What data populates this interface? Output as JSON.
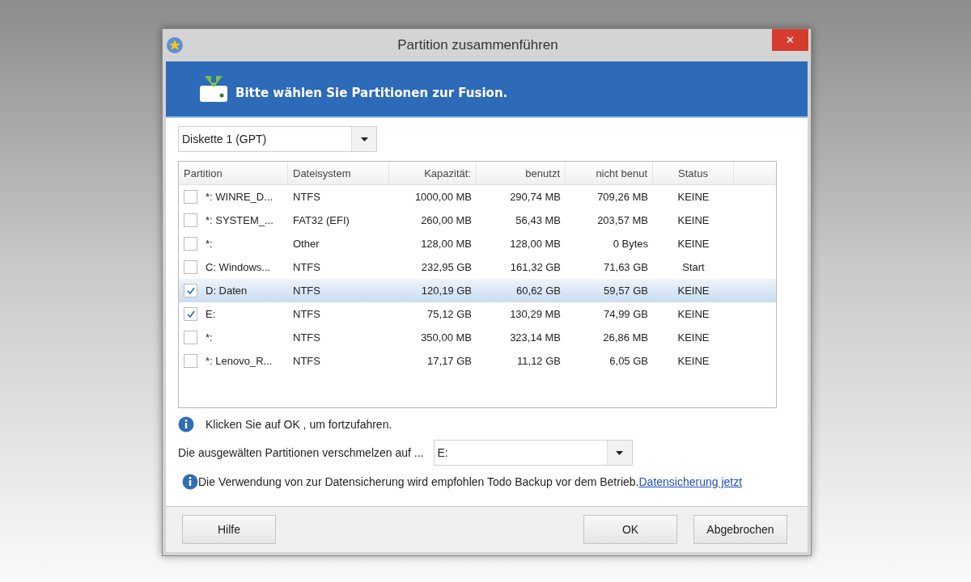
{
  "window": {
    "title": "Partition zusammenführen",
    "close": "✕"
  },
  "banner": {
    "text": "Bitte wählen Sie Partitionen zur Fusion."
  },
  "disk_select": {
    "value": "Diskette 1 (GPT)"
  },
  "table": {
    "columns": [
      "Partition",
      "Dateisystem",
      "Kapazität:",
      "benutzt",
      "nicht benut",
      "Status"
    ],
    "rows": [
      {
        "checked": false,
        "selected": false,
        "cells": [
          "*: WINRE_D...",
          "NTFS",
          "1000,00 MB",
          "290,74 MB",
          "709,26 MB",
          "KEINE"
        ]
      },
      {
        "checked": false,
        "selected": false,
        "cells": [
          "*: SYSTEM_...",
          "FAT32 (EFI)",
          "260,00 MB",
          "56,43 MB",
          "203,57 MB",
          "KEINE"
        ]
      },
      {
        "checked": false,
        "selected": false,
        "cells": [
          "*:",
          "Other",
          "128,00 MB",
          "128,00 MB",
          "0 Bytes",
          "KEINE"
        ]
      },
      {
        "checked": false,
        "selected": false,
        "cells": [
          "C: Windows...",
          "NTFS",
          "232,95 GB",
          "161,32 GB",
          "71,63 GB",
          "Start"
        ]
      },
      {
        "checked": true,
        "selected": true,
        "cells": [
          "D: Daten",
          "NTFS",
          "120,19 GB",
          "60,62 GB",
          "59,57 GB",
          "KEINE"
        ]
      },
      {
        "checked": true,
        "selected": false,
        "cells": [
          "E:",
          "NTFS",
          "75,12 GB",
          "130,29 MB",
          "74,99 GB",
          "KEINE"
        ]
      },
      {
        "checked": false,
        "selected": false,
        "cells": [
          "*:",
          "NTFS",
          "350,00 MB",
          "323,14 MB",
          "26,86 MB",
          "KEINE"
        ]
      },
      {
        "checked": false,
        "selected": false,
        "cells": [
          "*: Lenovo_R...",
          "NTFS",
          "17,17 GB",
          "11,12 GB",
          "6,05 GB",
          "KEINE"
        ]
      }
    ]
  },
  "hint": "Klicken Sie auf OK , um fortzufahren.",
  "merge_target": {
    "label": "Die ausgewälten Partitionen verschmelzen auf ...",
    "value": "E:"
  },
  "backup_note": {
    "text": "Die Verwendung von zur Datensicherung wird empfohlen Todo Backup vor dem Betrieb.",
    "link": "Datensicherung jetzt"
  },
  "buttons": {
    "help": "Hilfe",
    "ok": "OK",
    "cancel": "Abgebrochen"
  }
}
